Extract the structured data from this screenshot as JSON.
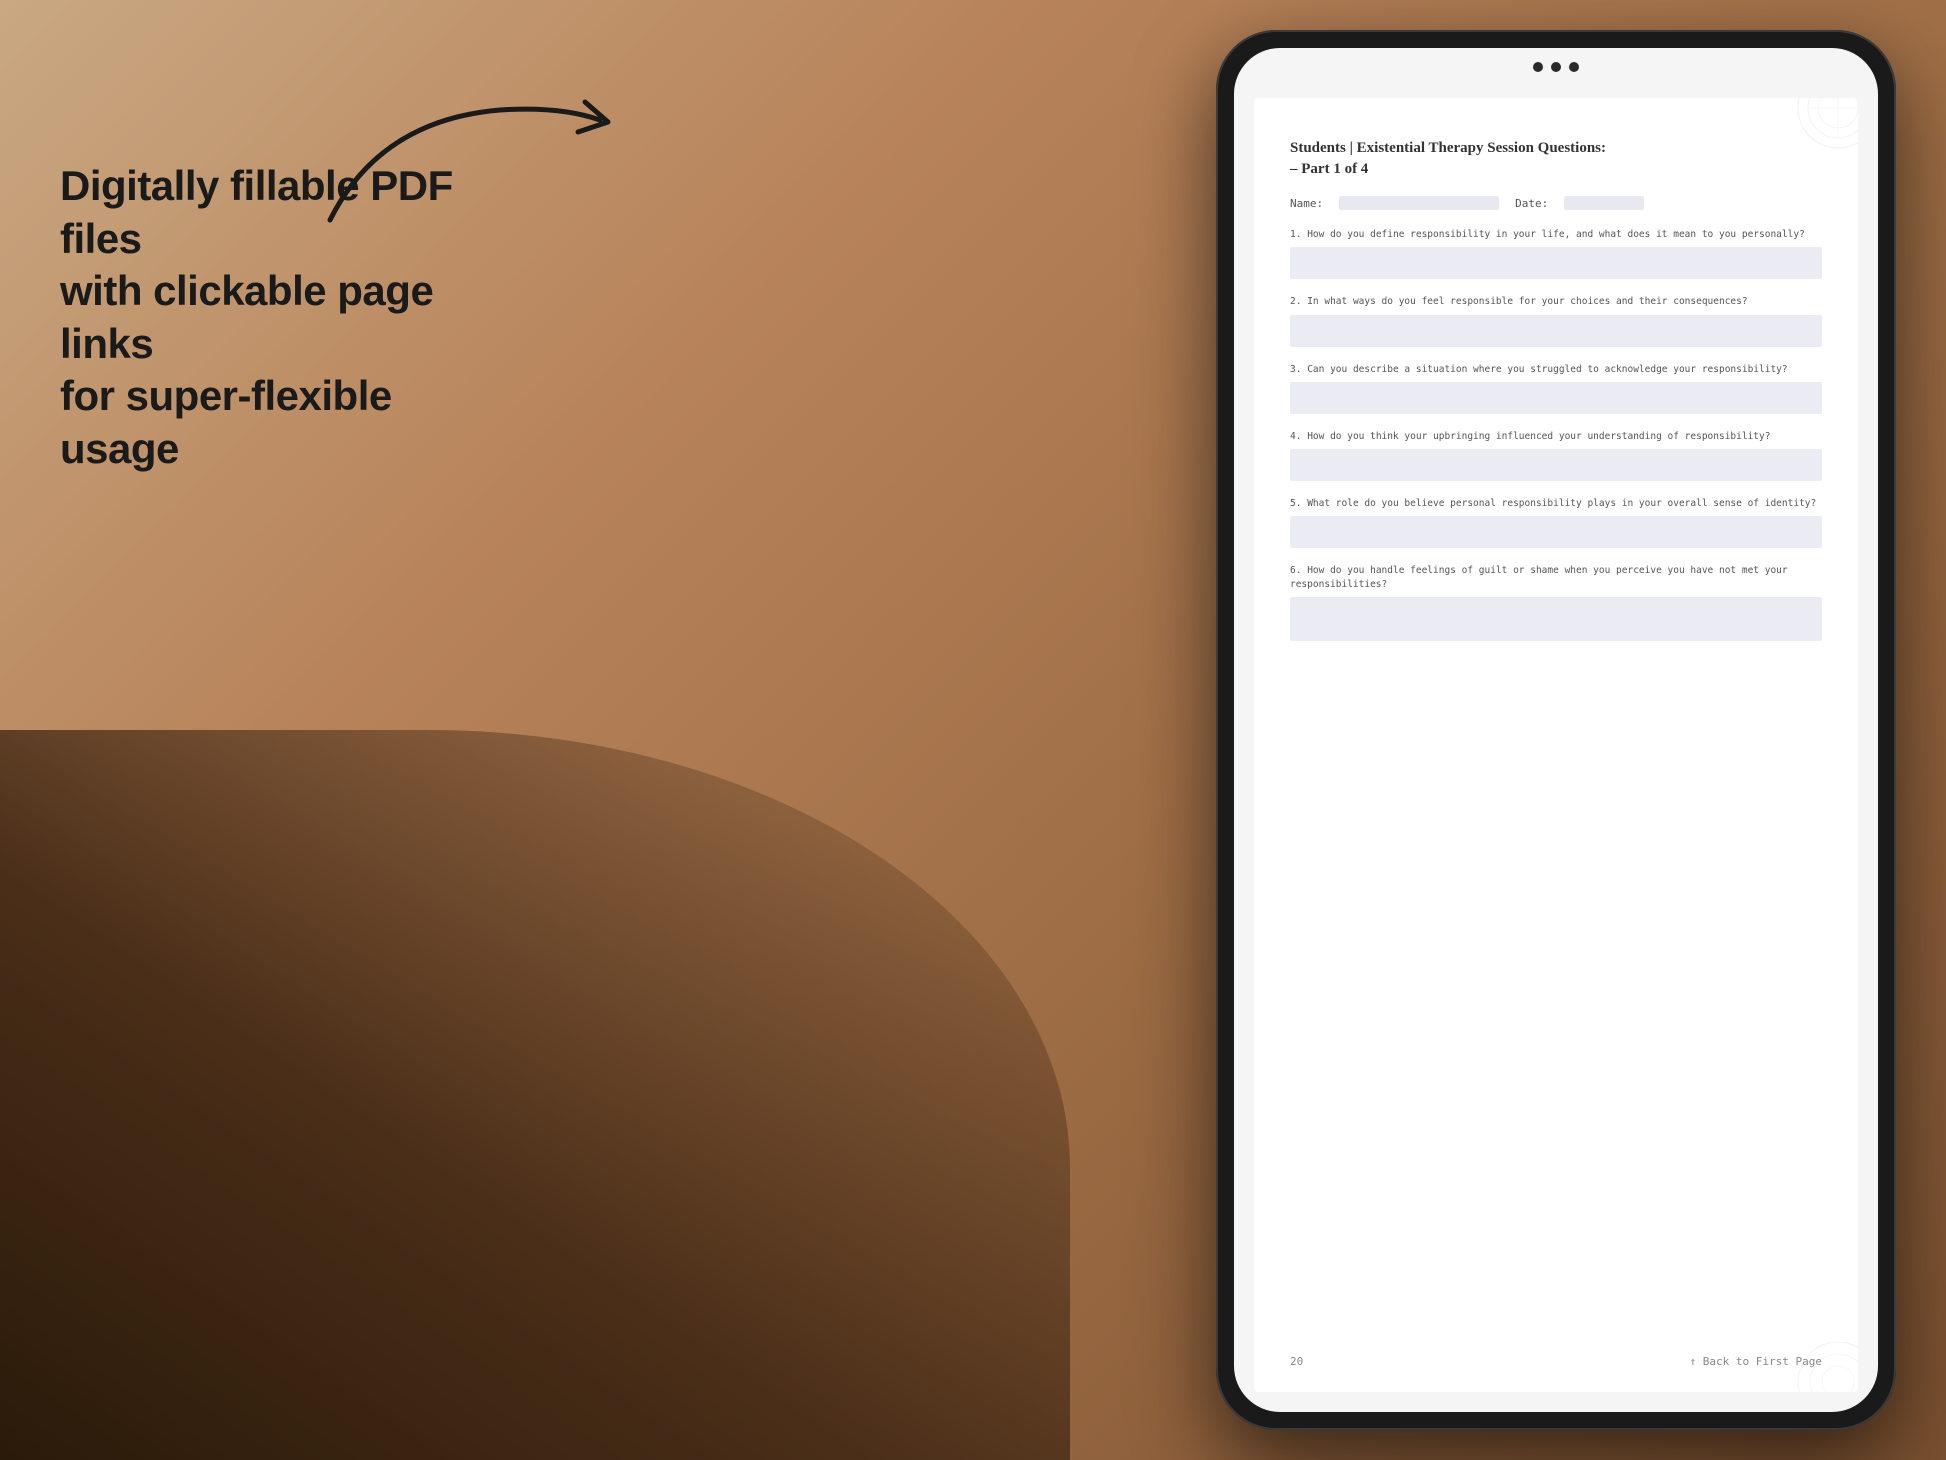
{
  "background": {
    "color_top": "#c9a882",
    "color_bottom": "#7a5030"
  },
  "left_text": {
    "line1": "Digitally fillable PDF files",
    "line2": "with clickable page links",
    "line3": "for super-flexible usage"
  },
  "arrow": {
    "description": "curved arrow pointing right toward tablet"
  },
  "tablet": {
    "camera_dots": 3
  },
  "pdf": {
    "title_line1": "Students | Existential Therapy Session Questions:",
    "title_line2": "– Part 1 of 4",
    "name_label": "Name:",
    "date_label": "Date:",
    "questions": [
      {
        "number": "1.",
        "text": "How do you define responsibility in your life, and what does it mean to you personally?"
      },
      {
        "number": "2.",
        "text": "In what ways do you feel responsible for your choices and their consequences?"
      },
      {
        "number": "3.",
        "text": "Can you describe a situation where you struggled to acknowledge your responsibility?"
      },
      {
        "number": "4.",
        "text": "How do you think your upbringing influenced your understanding of responsibility?"
      },
      {
        "number": "5.",
        "text": "What role do you believe personal responsibility plays in your overall sense of identity?"
      },
      {
        "number": "6.",
        "text": "How do you handle feelings of guilt or shame when you perceive you have not met your responsibilities?"
      }
    ],
    "footer": {
      "page_number": "20",
      "back_link": "↑ Back to First Page"
    }
  }
}
